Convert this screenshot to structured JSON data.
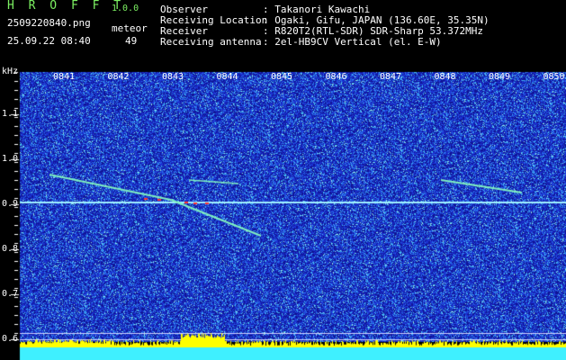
{
  "header": {
    "app_title": "H R O F F T",
    "app_version": "1.0.0",
    "file_name": "2509220840.png",
    "meteor_label": "meteor",
    "timestamp": "25.09.22 08:40",
    "meteor_count": "49"
  },
  "station_info": [
    {
      "label": "Observer",
      "value": ": Takanori Kawachi"
    },
    {
      "label": "Receiving Location",
      "value": ": Ogaki, Gifu, JAPAN (136.60E, 35.35N)"
    },
    {
      "label": "Receiver",
      "value": ": R820T2(RTL-SDR) SDR-Sharp 53.372MHz"
    },
    {
      "label": "Receiving antenna",
      "value": ": 2el-HB9CV Vertical (el. E-W)"
    }
  ],
  "y_axis": {
    "unit": "kHz",
    "ticks": [
      "1.1",
      "1.0",
      "0.9",
      "0.8",
      "0.7",
      "0.6"
    ]
  },
  "x_axis": {
    "ticks": [
      "0841",
      "0842",
      "0843",
      "0844",
      "0845",
      "0846",
      "0847",
      "0848",
      "0849",
      "0850"
    ]
  },
  "colors": {
    "background_noise": "#1a2cc8",
    "header_green": "#7cf062",
    "meteor_trace": "#7ff0c0",
    "carrier_line": "#9ff0ff",
    "level_bar": "#ffff00",
    "bottom_band": "#3ff0ff"
  }
}
